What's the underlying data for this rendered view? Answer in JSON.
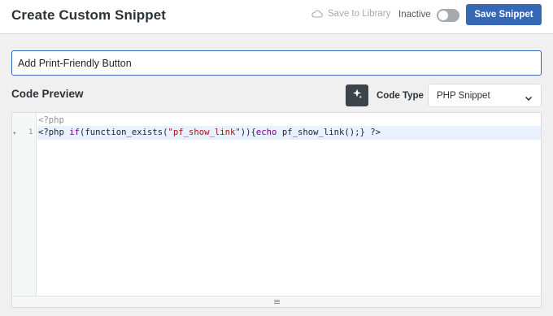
{
  "header": {
    "title": "Create Custom Snippet",
    "save_to_library_label": "Save to Library",
    "save_to_library_icon": "cloud-icon",
    "status_label": "Inactive",
    "active_toggle_on": false,
    "save_button_label": "Save Snippet",
    "accent_color": "#3568b7"
  },
  "snippet": {
    "title_value": "Add Print-Friendly Button"
  },
  "code_preview": {
    "section_title": "Code Preview",
    "magic_button_icon": "sparkle-icon",
    "code_type_label": "Code Type",
    "code_type_selected": "PHP Snippet",
    "editor": {
      "placeholder": "<?php",
      "fold_marker": "▾",
      "lines": [
        {
          "number": "1",
          "tokens": [
            {
              "text": "<?php ",
              "type": "plain"
            },
            {
              "text": "if",
              "type": "keyword"
            },
            {
              "text": "(function_exists(",
              "type": "plain"
            },
            {
              "text": "\"pf_show_link\"",
              "type": "string"
            },
            {
              "text": ")){",
              "type": "plain"
            },
            {
              "text": "echo",
              "type": "keyword"
            },
            {
              "text": " pf_show_link();} ?>",
              "type": "plain"
            }
          ]
        }
      ]
    }
  }
}
